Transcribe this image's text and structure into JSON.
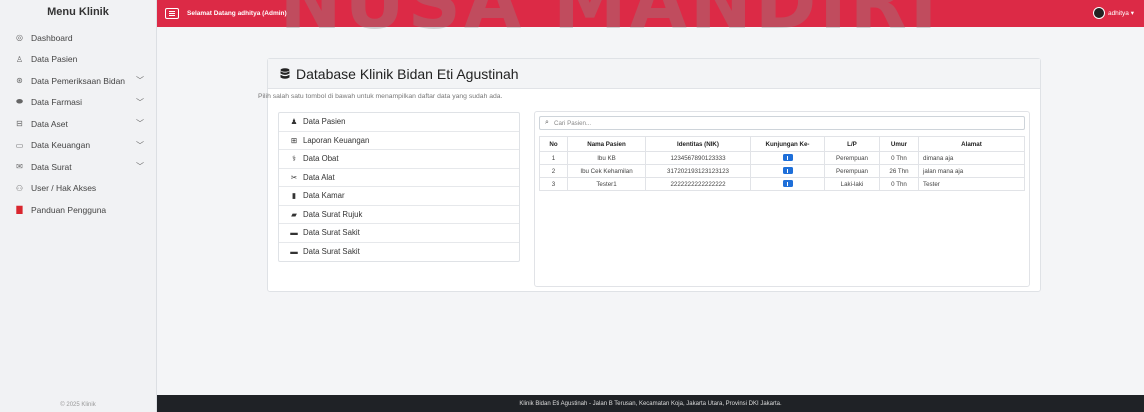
{
  "sidebar": {
    "brand": "Menu Klinik",
    "items": [
      {
        "label": "Dashboard",
        "icon": "dashboard-icon",
        "glyph": "◎",
        "chevron": false
      },
      {
        "label": "Data Pasien",
        "icon": "user-icon",
        "glyph": "♙",
        "chevron": false
      },
      {
        "label": "Data Pemeriksaan Bidan",
        "icon": "stethoscope-icon",
        "glyph": "⊛",
        "chevron": true
      },
      {
        "label": "Data Farmasi",
        "icon": "pill-icon",
        "glyph": "⬬",
        "chevron": true
      },
      {
        "label": "Data Aset",
        "icon": "asset-icon",
        "glyph": "⊟",
        "chevron": true
      },
      {
        "label": "Data Keuangan",
        "icon": "wallet-icon",
        "glyph": "▭",
        "chevron": true
      },
      {
        "label": "Data Surat",
        "icon": "mail-icon",
        "glyph": "✉",
        "chevron": true
      },
      {
        "label": "User / Hak Akses",
        "icon": "users-icon",
        "glyph": "⚇",
        "chevron": false
      },
      {
        "label": "Panduan Pengguna",
        "icon": "pdf-icon",
        "glyph": "▇",
        "chevron": false
      }
    ],
    "copyright": "© 2025 Klinik"
  },
  "topbar": {
    "welcome": "Selamat Datang adhitya (Admin)",
    "username": "adhitya"
  },
  "watermark": "NUSA MANDIRI",
  "card": {
    "title": "Database Klinik Bidan Eti Agustinah",
    "subtitle": "Pilih salah satu tombol di bawah untuk menampilkan daftar data yang sudah ada."
  },
  "buttons": [
    {
      "label": "Data Pasien",
      "icon": "person-icon",
      "glyph": "♟"
    },
    {
      "label": "Laporan Keuangan",
      "icon": "report-icon",
      "glyph": "⊞"
    },
    {
      "label": "Data Obat",
      "icon": "capsules-icon",
      "glyph": "⚕"
    },
    {
      "label": "Data Alat",
      "icon": "tools-icon",
      "glyph": "✂"
    },
    {
      "label": "Data Kamar",
      "icon": "building-icon",
      "glyph": "▮"
    },
    {
      "label": "Data Surat Rujuk",
      "icon": "ambulance-icon",
      "glyph": "▰"
    },
    {
      "label": "Data Surat Sakit",
      "icon": "envelope-icon",
      "glyph": "▬"
    },
    {
      "label": "Data Surat Sakit",
      "icon": "envelope-icon",
      "glyph": "▬"
    }
  ],
  "search": {
    "placeholder": "Cari Pasien..."
  },
  "table": {
    "headers": [
      "No",
      "Nama Pasien",
      "Identitas (NIK)",
      "Kunjungan Ke-",
      "L/P",
      "Umur",
      "Alamat"
    ],
    "rows": [
      {
        "no": "1",
        "nama": "Ibu KB",
        "nik": "1234567890123333",
        "kunjungan": "1",
        "lp": "Perempuan",
        "umur": "0 Thn",
        "alamat": "dimana aja"
      },
      {
        "no": "2",
        "nama": "Ibu Cek Kehamilan",
        "nik": "3172021931231231​23",
        "kunjungan": "1",
        "lp": "Perempuan",
        "umur": "26 Thn",
        "alamat": "jalan mana aja"
      },
      {
        "no": "3",
        "nama": "Tester1",
        "nik": "2222222222222222",
        "kunjungan": "1",
        "lp": "Laki-laki",
        "umur": "0 Thn",
        "alamat": "Tester"
      }
    ]
  },
  "footer": "Klinik Bidan Eti Agustinah - Jalan B Terusan, Kecamatan Koja, Jakarta Utara, Provinsi DKI Jakarta.",
  "colors": {
    "topbar": "#dc2a46",
    "footer": "#1f2226",
    "badge": "#1e6fd9"
  }
}
